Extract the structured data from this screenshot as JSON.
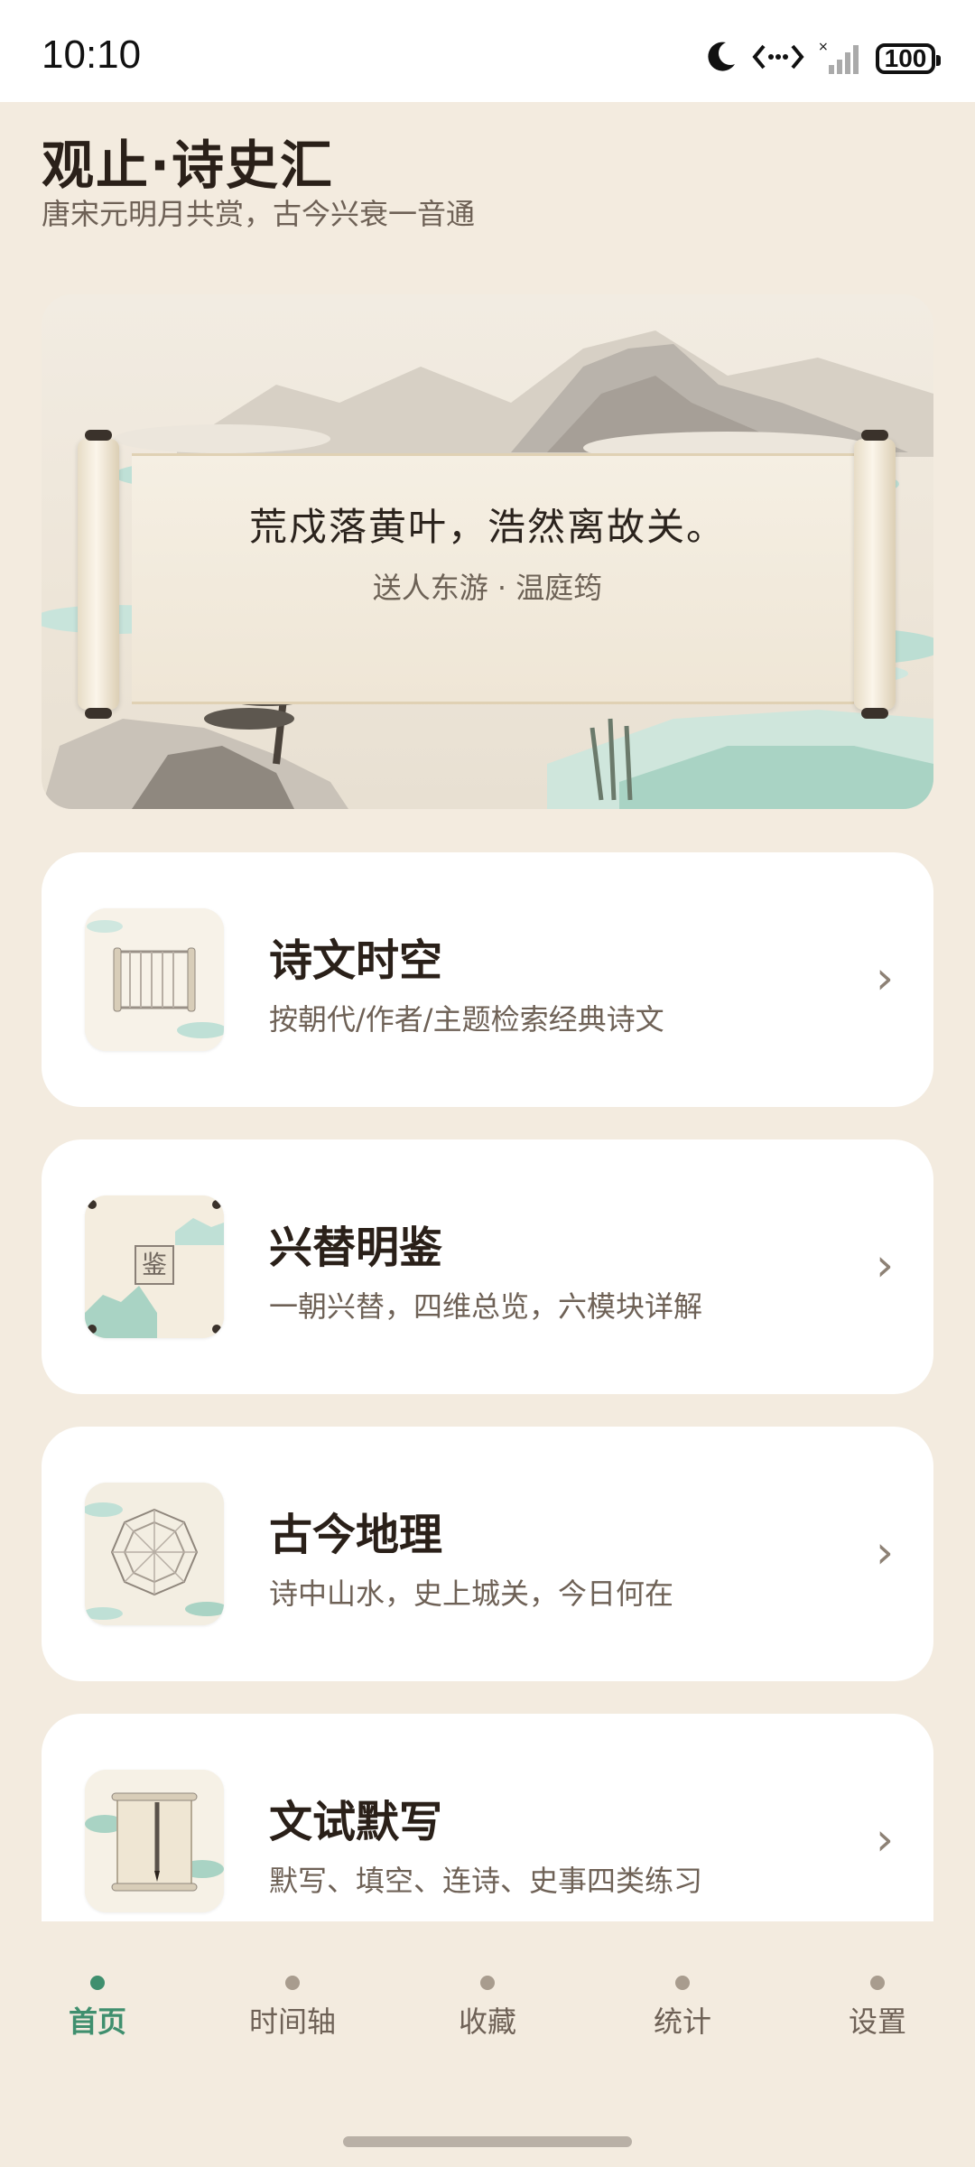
{
  "status_bar": {
    "time": "10:10",
    "battery": "100",
    "icons": [
      "moon-icon",
      "data-transfer-icon",
      "signal-icon",
      "battery-icon"
    ]
  },
  "header": {
    "title": "观止·诗史汇",
    "subtitle": "唐宋元明月共赏，古今兴衰一音通"
  },
  "hero": {
    "quote": "荒戍落黄叶，浩然离故关。",
    "source": "送人东游 · 温庭筠"
  },
  "cards": [
    {
      "title": "诗文时空",
      "desc": "按朝代/作者/主题检索经典诗文",
      "icon": "scroll-icon"
    },
    {
      "title": "兴替明鉴",
      "desc": "一朝兴替，四维总览，六模块详解",
      "icon": "mirror-seal-icon",
      "seal_char": "鉴"
    },
    {
      "title": "古今地理",
      "desc": "诗中山水，史上城关，今日何在",
      "icon": "compass-map-icon"
    },
    {
      "title": "文试默写",
      "desc": "默写、填空、连诗、史事四类练习",
      "icon": "brush-scroll-icon"
    }
  ],
  "bottom_nav": [
    {
      "label": "首页",
      "active": true
    },
    {
      "label": "时间轴",
      "active": false
    },
    {
      "label": "收藏",
      "active": false
    },
    {
      "label": "统计",
      "active": false
    },
    {
      "label": "设置",
      "active": false
    }
  ],
  "colors": {
    "background": "#f3ebdf",
    "card": "#ffffff",
    "accent": "#3f8f6e",
    "text_primary": "#2a2019",
    "text_secondary": "#6e6156"
  }
}
